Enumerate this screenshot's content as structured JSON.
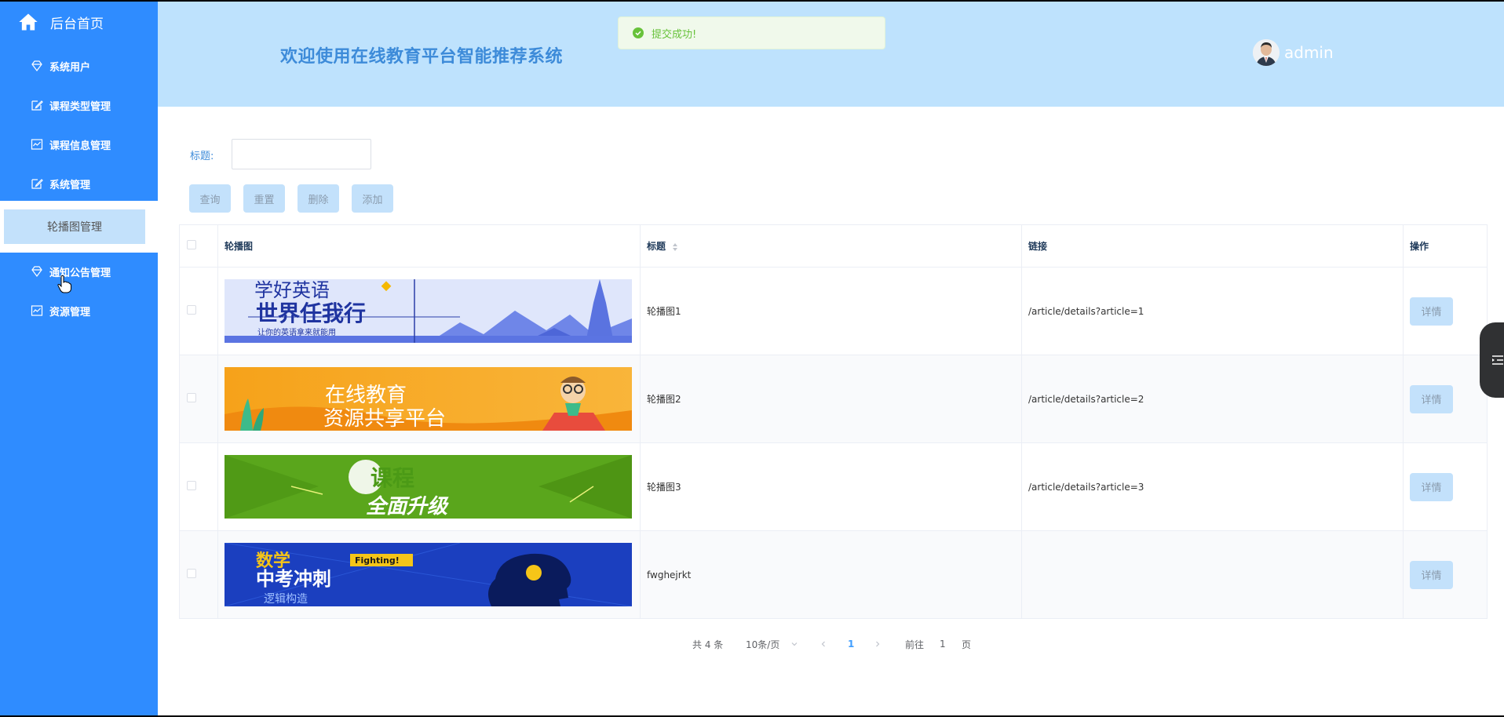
{
  "sidebar": {
    "home_label": "后台首页",
    "items": [
      {
        "label": "系统用户",
        "icon": "diamond-icon"
      },
      {
        "label": "课程类型管理",
        "icon": "edit-icon"
      },
      {
        "label": "课程信息管理",
        "icon": "chart-icon"
      },
      {
        "label": "系统管理",
        "icon": "edit-icon"
      },
      {
        "label": "通知公告管理",
        "icon": "diamond-icon"
      },
      {
        "label": "资源管理",
        "icon": "chart-icon"
      }
    ],
    "active_sub": "轮播图管理"
  },
  "header": {
    "welcome": "欢迎使用在线教育平台智能推荐系统",
    "username": "admin"
  },
  "toast": {
    "message": "提交成功!"
  },
  "search": {
    "title_label": "标题:",
    "title_value": "",
    "buttons": {
      "query": "查询",
      "reset": "重置",
      "delete": "删除",
      "add": "添加"
    }
  },
  "table": {
    "headers": {
      "image": "轮播图",
      "title": "标题",
      "link": "链接",
      "action": "操作"
    },
    "rows": [
      {
        "title": "轮播图1",
        "link": "/article/details?article=1",
        "action": "详情",
        "banner": {
          "line1": "学好英语",
          "line2": "世界任我行",
          "line3": "让你的英语拿来就能用"
        }
      },
      {
        "title": "轮播图2",
        "link": "/article/details?article=2",
        "action": "详情",
        "banner": {
          "line1": "在线教育",
          "line2": "资源共享平台"
        }
      },
      {
        "title": "轮播图3",
        "link": "/article/details?article=3",
        "action": "详情",
        "banner": {
          "line1": "课程",
          "line2": "全面升级"
        }
      },
      {
        "title": "fwghejrkt",
        "link": "",
        "action": "详情",
        "banner": {
          "line1": "数学",
          "line2": "中考冲刺",
          "line3": "逻辑构造",
          "tag": "Fighting!"
        }
      }
    ]
  },
  "pagination": {
    "total": "共 4 条",
    "page_size": "10条/页",
    "current_page": "1",
    "goto_label": "前往",
    "goto_value": "1",
    "page_suffix": "页"
  },
  "colors": {
    "sidebar": "#2f8cff",
    "header": "#bee2fd",
    "accent": "#3d8bd9",
    "button": "#c3e1fb",
    "success": "#67c23a"
  }
}
